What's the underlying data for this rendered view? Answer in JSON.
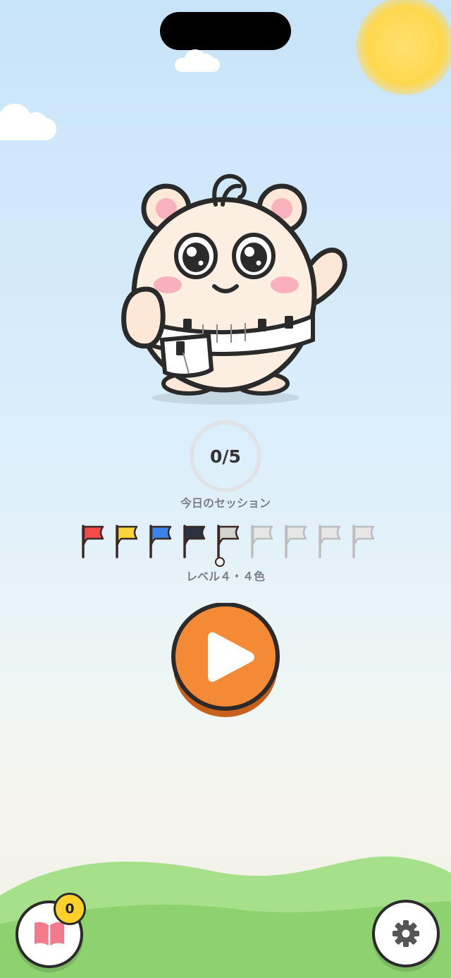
{
  "progress": {
    "completed": 0,
    "total": 5,
    "count_text": "0/5",
    "label": "今日のセッション"
  },
  "flags": {
    "colors": [
      "#f44a4a",
      "#fcd43a",
      "#3b82e8",
      "#2d3240",
      "#d6d2cc",
      "#e6e6e6",
      "#e6e6e6",
      "#e6e6e6",
      "#e6e6e6"
    ],
    "current_index": 4
  },
  "level": {
    "label": "レベル４・４色"
  },
  "journal": {
    "icon": "book-icon",
    "badge_count": "0"
  },
  "settings": {
    "icon": "gear-icon"
  },
  "colors": {
    "accent": "#f58a36",
    "ring": "#dfe3e8",
    "outline": "#2a2a2a",
    "book": "#f27a8a",
    "gear": "#555555"
  }
}
